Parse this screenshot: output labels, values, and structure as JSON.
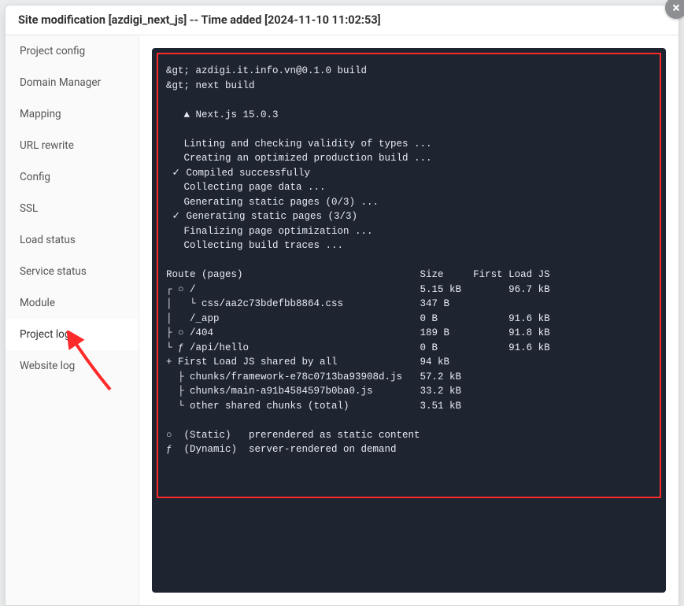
{
  "header": {
    "title": "Site modification [azdigi_next_js] -- Time added [2024-11-10 11:02:53]"
  },
  "sidebar": {
    "items": [
      {
        "label": "Project config"
      },
      {
        "label": "Domain Manager"
      },
      {
        "label": "Mapping"
      },
      {
        "label": "URL rewrite"
      },
      {
        "label": "Config"
      },
      {
        "label": "SSL"
      },
      {
        "label": "Load status"
      },
      {
        "label": "Service status"
      },
      {
        "label": "Module"
      },
      {
        "label": "Project log"
      },
      {
        "label": "Website log"
      }
    ],
    "active_index": 9
  },
  "close_label": "×",
  "terminal": {
    "lines": [
      "&gt; azdigi.it.info.vn@0.1.0 build",
      "&gt; next build",
      "",
      "   ▲ Next.js 15.0.3",
      "",
      "   Linting and checking validity of types ...",
      "   Creating an optimized production build ...",
      " ✓ Compiled successfully",
      "   Collecting page data ...",
      "   Generating static pages (0/3) ...",
      " ✓ Generating static pages (3/3)",
      "   Finalizing page optimization ...",
      "   Collecting build traces ...",
      "",
      "Route (pages)                              Size     First Load JS",
      "┌ ○ /                                      5.15 kB        96.7 kB",
      "│   └ css/aa2c73bdefbb8864.css             347 B",
      "│   /_app                                  0 B            91.6 kB",
      "├ ○ /404                                   189 B          91.8 kB",
      "└ ƒ /api/hello                             0 B            91.6 kB",
      "+ First Load JS shared by all              94 kB",
      "  ├ chunks/framework-e78c0713ba93908d.js   57.2 kB",
      "  ├ chunks/main-a91b4584597b0ba0.js        33.2 kB",
      "  └ other shared chunks (total)            3.51 kB",
      "",
      "○  (Static)   prerendered as static content",
      "ƒ  (Dynamic)  server-rendered on demand"
    ]
  }
}
